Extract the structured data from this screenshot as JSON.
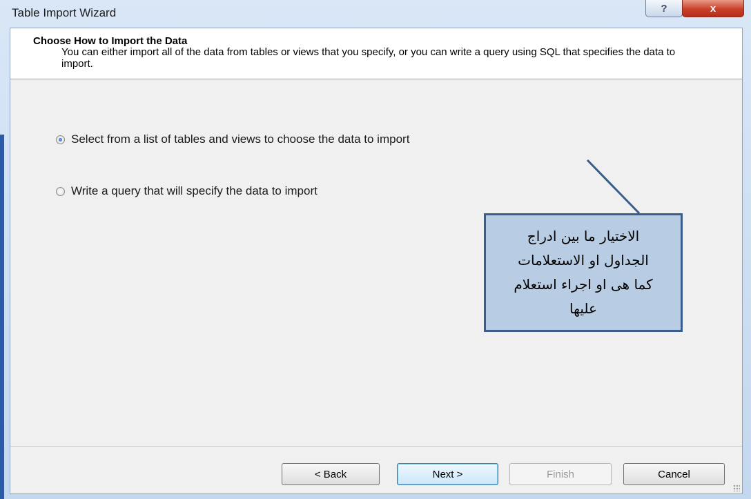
{
  "window": {
    "title": "Table Import Wizard",
    "help_glyph": "?",
    "close_glyph": "x"
  },
  "header": {
    "title": "Choose How to Import the Data",
    "description": "You can either import all of the data from tables or views that you specify, or you can write a query using SQL that specifies the data to import."
  },
  "options": [
    {
      "label": "Select from a list of tables and views to choose the data to import",
      "selected": true
    },
    {
      "label": "Write a query that will specify the data to import",
      "selected": false
    }
  ],
  "callout": {
    "lines": [
      "الاختيار ما بين ادراج",
      "الجداول او الاستعلامات",
      "كما هى او اجراء استعلام",
      "عليها"
    ]
  },
  "buttons": {
    "back": "< Back",
    "next": "Next >",
    "finish": "Finish",
    "cancel": "Cancel"
  }
}
